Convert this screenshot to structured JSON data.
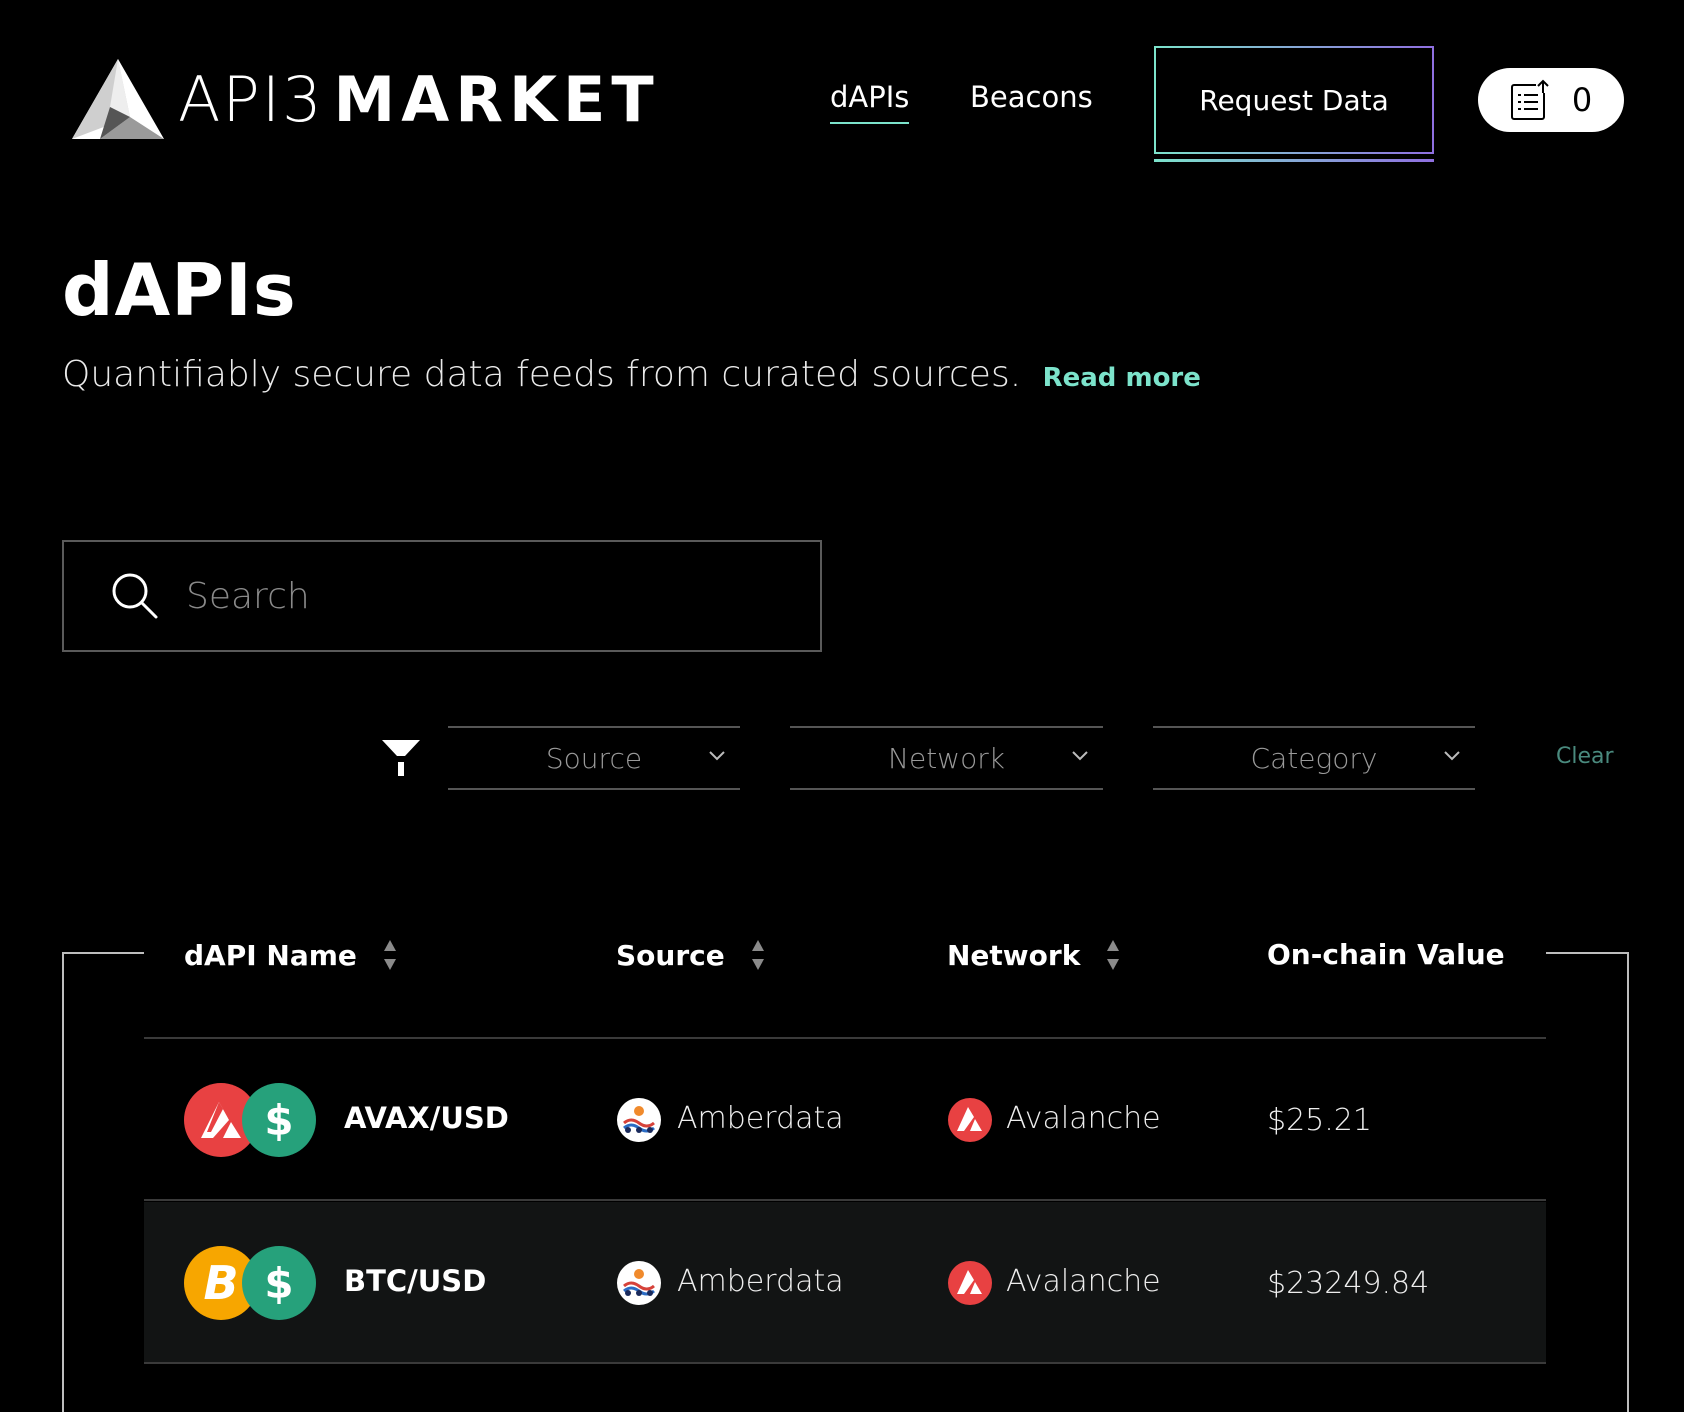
{
  "header": {
    "logo_api3": "API3",
    "logo_market": "MARKET",
    "nav": [
      {
        "label": "dAPIs",
        "active": true
      },
      {
        "label": "Beacons",
        "active": false
      }
    ],
    "request_button": "Request Data",
    "cart_count": "0"
  },
  "page": {
    "title": "dAPIs",
    "subtitle": "Quantifiably secure data feeds from curated sources.",
    "read_more": "Read more"
  },
  "search": {
    "placeholder": "Search",
    "value": ""
  },
  "filters": {
    "source": "Source",
    "network": "Network",
    "category": "Category",
    "clear": "Clear"
  },
  "table": {
    "columns": [
      "dAPI Name",
      "Source",
      "Network",
      "On-chain Value"
    ],
    "rows": [
      {
        "name": "AVAX/USD",
        "base_icon": "avalanche-icon",
        "quote_icon": "dollar-icon",
        "source": "Amberdata",
        "network": "Avalanche",
        "value": "$25.21"
      },
      {
        "name": "BTC/USD",
        "base_icon": "bitcoin-icon",
        "quote_icon": "dollar-icon",
        "source": "Amberdata",
        "network": "Avalanche",
        "value": "$23249.84"
      }
    ]
  },
  "colors": {
    "background": "#000000",
    "accent": "#7ce3cb",
    "accent_purple": "#8f6fe0",
    "avalanche_red": "#e84142",
    "usd_green": "#26a17b",
    "bitcoin_orange": "#f7a600",
    "selected_row": "#121414"
  }
}
